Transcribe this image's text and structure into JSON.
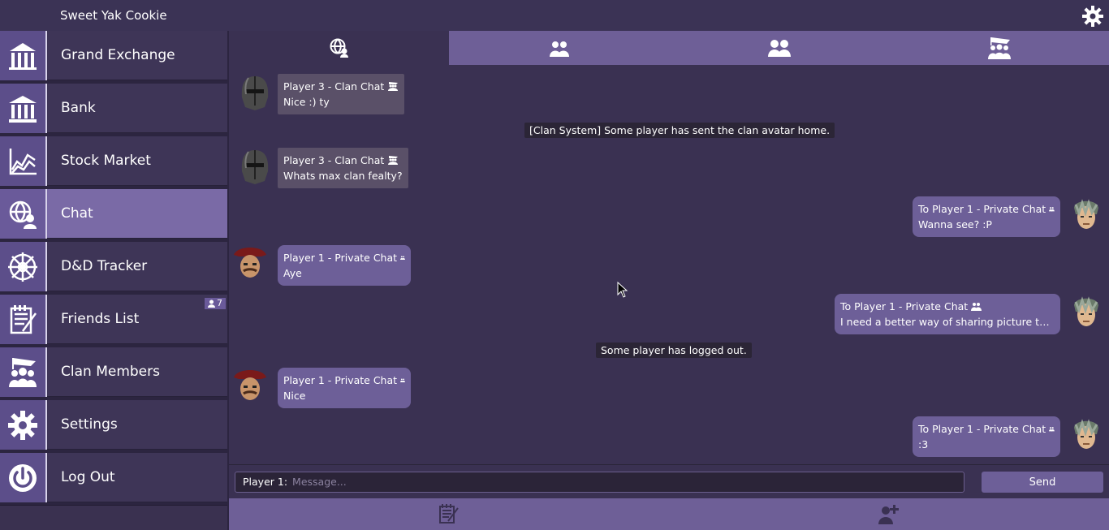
{
  "app": {
    "title": "Sweet Yak Cookie",
    "settings_icon": "gear-icon"
  },
  "sidebar": {
    "items": [
      {
        "label": "Grand Exchange",
        "icon": "grand-exchange-icon"
      },
      {
        "label": "Bank",
        "icon": "bank-icon"
      },
      {
        "label": "Stock Market",
        "icon": "stock-chart-icon"
      },
      {
        "label": "Chat",
        "icon": "chat-globe-icon",
        "active": true
      },
      {
        "label": "D&D Tracker",
        "icon": "ship-wheel-icon"
      },
      {
        "label": "Friends List",
        "icon": "notepad-icon",
        "badge": "7"
      },
      {
        "label": "Clan Members",
        "icon": "clan-flag-icon"
      },
      {
        "label": "Settings",
        "icon": "gear-icon"
      },
      {
        "label": "Log Out",
        "icon": "power-icon"
      }
    ]
  },
  "tabs": [
    {
      "icon": "globe-user-icon",
      "active": true
    },
    {
      "icon": "friends-icon"
    },
    {
      "icon": "group-icon"
    },
    {
      "icon": "clan-icon"
    }
  ],
  "messages": [
    {
      "kind": "clan",
      "head": "Player 3 - Clan Chat",
      "body": "Nice :) ty"
    },
    {
      "kind": "system",
      "text": "[Clan System] Some player has sent the clan avatar home."
    },
    {
      "kind": "clan",
      "head": "Player 3 - Clan Chat",
      "body": "Whats max clan fealty?"
    },
    {
      "kind": "out",
      "head": "To Player 1 - Private Chat",
      "body": "Wanna see? :P"
    },
    {
      "kind": "in",
      "head": "Player 1 - Private Chat",
      "body": "Aye"
    },
    {
      "kind": "out",
      "head": "To Player 1 - Private Chat",
      "body": "I need a better way of sharing picture to rs..."
    },
    {
      "kind": "system",
      "text": "Some player has logged out."
    },
    {
      "kind": "in",
      "head": "Player 1 - Private Chat",
      "body": "Nice"
    },
    {
      "kind": "out",
      "head": "To Player 1 - Private Chat",
      "body": ":3"
    }
  ],
  "input": {
    "recipient": "Player 1:",
    "placeholder": "Message...",
    "send_label": "Send"
  },
  "bottom_icons": [
    "notes-icon",
    "add-friend-icon"
  ]
}
